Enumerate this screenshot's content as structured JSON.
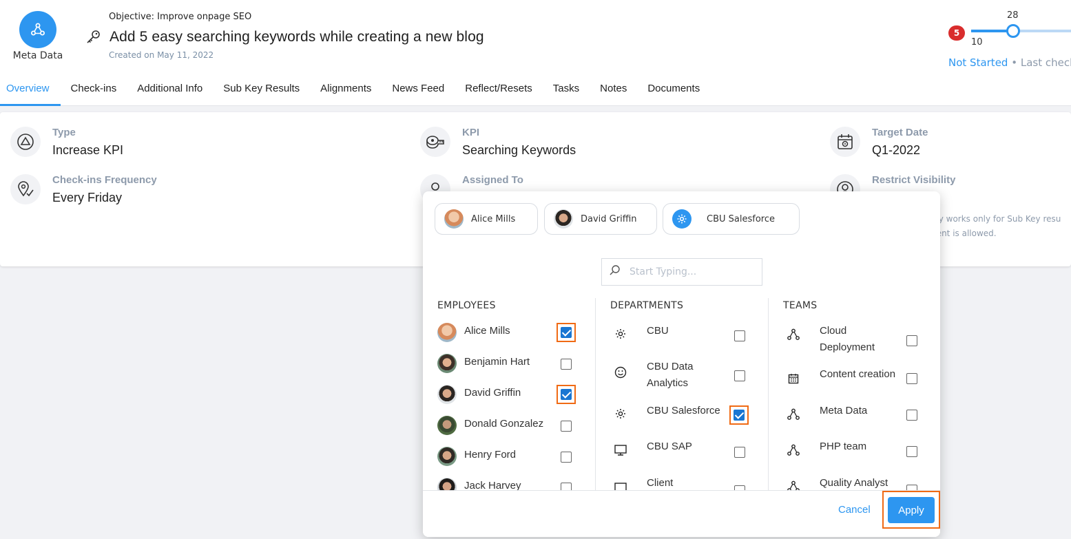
{
  "header": {
    "team_label": "Meta Data",
    "objective": "Objective:  Improve onpage SEO",
    "title": "Add 5 easy searching keywords while creating a new blog",
    "created": "Created on May 11, 2022",
    "badge_count": "5",
    "progress_value": "28",
    "progress_min": "10",
    "progress_fraction": 0.41,
    "status": "Not Started",
    "status_suffix": " • Last checke"
  },
  "tabs": [
    "Overview",
    "Check-ins",
    "Additional Info",
    "Sub Key Results",
    "Alignments",
    "News Feed",
    "Reflect/Resets",
    "Tasks",
    "Notes",
    "Documents"
  ],
  "details": {
    "type": {
      "label": "Type",
      "value": "Increase KPI"
    },
    "kpi": {
      "label": "KPI",
      "value": "Searching Keywords"
    },
    "target_date": {
      "label": "Target Date",
      "value": "Q1-2022"
    },
    "frequency": {
      "label": "Check-ins Frequency",
      "value": "Every Friday"
    },
    "assigned": {
      "label": "Assigned To"
    },
    "visibility": {
      "label": "Restrict Visibility",
      "note_line1": "ility works only for Sub Key resu",
      "note_line2": "ment is allowed."
    }
  },
  "popup": {
    "chips": [
      "Alice Mills",
      "David Griffin",
      "CBU Salesforce"
    ],
    "search_placeholder": "Start Typing...",
    "employees": {
      "title": "EMPLOYEES",
      "items": [
        {
          "name": "Alice Mills",
          "checked": true
        },
        {
          "name": "Benjamin Hart",
          "checked": false
        },
        {
          "name": "David Griffin",
          "checked": true
        },
        {
          "name": "Donald Gonzalez",
          "checked": false
        },
        {
          "name": "Henry Ford",
          "checked": false
        },
        {
          "name": "Jack Harvey",
          "checked": false
        }
      ]
    },
    "departments": {
      "title": "DEPARTMENTS",
      "items": [
        {
          "name": "CBU",
          "icon": "gear-icon",
          "checked": false
        },
        {
          "name": "CBU Data Analytics",
          "icon": "smiley-icon",
          "checked": false
        },
        {
          "name": "CBU Salesforce",
          "icon": "gear-icon",
          "checked": true
        },
        {
          "name": "CBU SAP",
          "icon": "monitor-icon",
          "checked": false
        },
        {
          "name": "Client",
          "icon": "monitor-icon",
          "checked": false
        }
      ]
    },
    "teams": {
      "title": "TEAMS",
      "items": [
        {
          "name": "Cloud Deployment",
          "icon": "network-icon",
          "checked": false
        },
        {
          "name": "Content creation",
          "icon": "calendar-icon",
          "checked": false
        },
        {
          "name": "Meta Data",
          "icon": "network-icon",
          "checked": false
        },
        {
          "name": "PHP team",
          "icon": "network-icon",
          "checked": false
        },
        {
          "name": "Quality Analyst",
          "icon": "network-icon",
          "checked": false
        }
      ]
    },
    "cancel_label": "Cancel",
    "apply_label": "Apply"
  },
  "colors": {
    "accent": "#2d96f0",
    "highlight": "#f06a14",
    "badge": "#d92d2d",
    "muted": "#8d9aab"
  }
}
